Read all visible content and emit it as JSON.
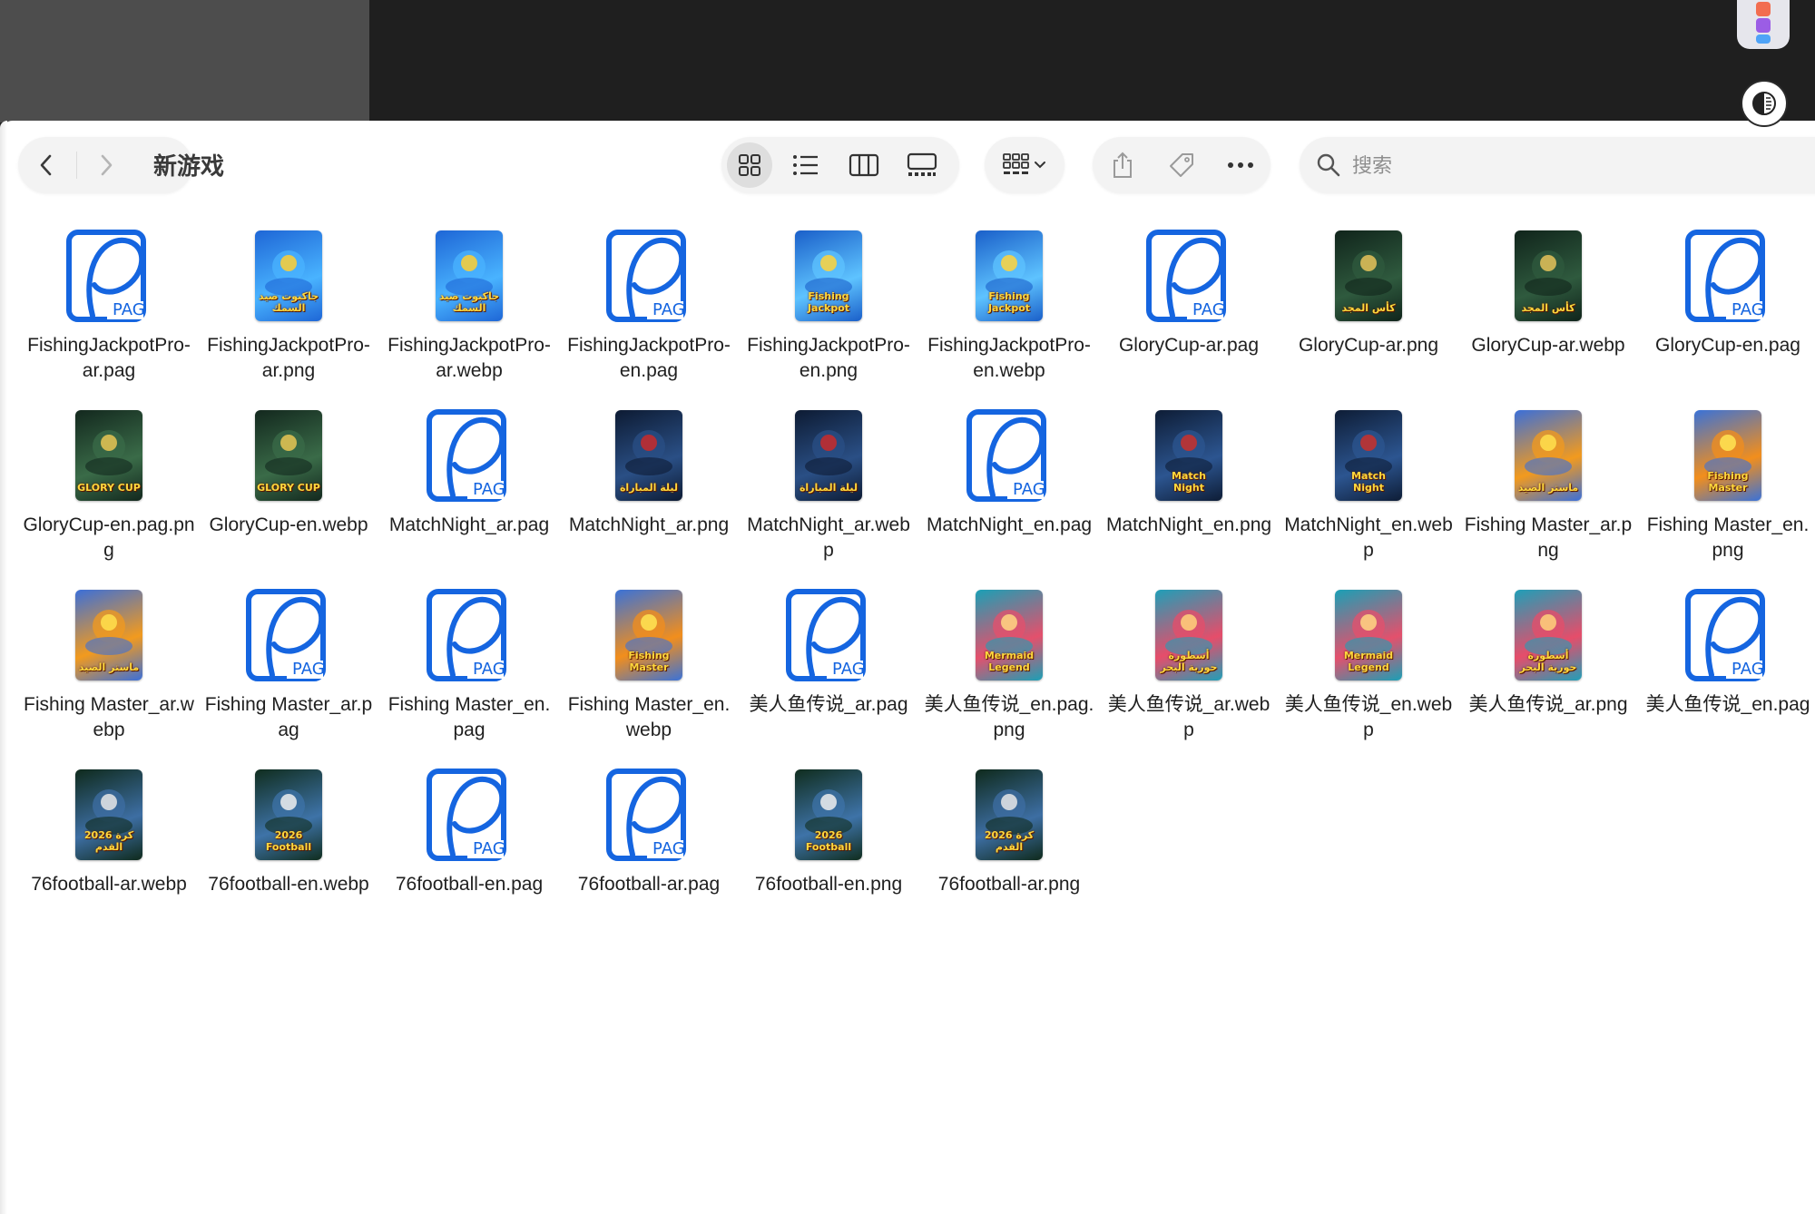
{
  "window": {
    "title": "新游戏",
    "search": {
      "placeholder": "搜索",
      "value": ""
    },
    "view_mode": "icons",
    "toolbar_icons": [
      "chevron-left-icon",
      "chevron-right-icon",
      "grid-view-icon",
      "list-view-icon",
      "column-view-icon",
      "gallery-view-icon",
      "group-by-icon",
      "share-icon",
      "tag-icon",
      "more-icon",
      "search-icon"
    ]
  },
  "files": [
    {
      "name": "FishingJackpotPro-ar.pag",
      "kind": "pag"
    },
    {
      "name": "FishingJackpotPro-ar.png",
      "kind": "img",
      "theme": "shark-ar"
    },
    {
      "name": "FishingJackpotPro-ar.webp",
      "kind": "img",
      "theme": "shark-ar"
    },
    {
      "name": "FishingJackpotPro-en.pag",
      "kind": "pag"
    },
    {
      "name": "FishingJackpotPro-en.png",
      "kind": "img",
      "theme": "shark-jackpot"
    },
    {
      "name": "FishingJackpotPro-en.webp",
      "kind": "img",
      "theme": "shark-jackpot"
    },
    {
      "name": "GloryCup-ar.pag",
      "kind": "pag"
    },
    {
      "name": "GloryCup-ar.png",
      "kind": "img",
      "theme": "glory-ar"
    },
    {
      "name": "GloryCup-ar.webp",
      "kind": "img",
      "theme": "glory-ar"
    },
    {
      "name": "GloryCup-en.pag",
      "kind": "pag"
    },
    {
      "name": "GloryCup-en.pag.png",
      "kind": "img",
      "theme": "glory-en"
    },
    {
      "name": "GloryCup-en.webp",
      "kind": "img",
      "theme": "glory-en"
    },
    {
      "name": "MatchNight_ar.pag",
      "kind": "pag"
    },
    {
      "name": "MatchNight_ar.png",
      "kind": "img",
      "theme": "match-ar"
    },
    {
      "name": "MatchNight_ar.webp",
      "kind": "img",
      "theme": "match-ar"
    },
    {
      "name": "MatchNight_en.pag",
      "kind": "pag"
    },
    {
      "name": "MatchNight_en.png",
      "kind": "img",
      "theme": "match-en"
    },
    {
      "name": "MatchNight_en.webp",
      "kind": "img",
      "theme": "match-en"
    },
    {
      "name": "Fishing Master_ar.png",
      "kind": "img",
      "theme": "fm-ar"
    },
    {
      "name": "Fishing Master_en.png",
      "kind": "img",
      "theme": "fm-en"
    },
    {
      "name": "Fishing Master_ar.webp",
      "kind": "img",
      "theme": "fm-ar"
    },
    {
      "name": "Fishing Master_ar.pag",
      "kind": "pag"
    },
    {
      "name": "Fishing Master_en.pag",
      "kind": "pag"
    },
    {
      "name": "Fishing Master_en.webp",
      "kind": "img",
      "theme": "fm-en"
    },
    {
      "name": "美人鱼传说_ar.pag",
      "kind": "pag"
    },
    {
      "name": "美人鱼传说_en.pag.png",
      "kind": "img",
      "theme": "mermaid-en"
    },
    {
      "name": "美人鱼传说_ar.webp",
      "kind": "img",
      "theme": "mermaid-ar"
    },
    {
      "name": "美人鱼传说_en.webp",
      "kind": "img",
      "theme": "mermaid-en"
    },
    {
      "name": "美人鱼传说_ar.png",
      "kind": "img",
      "theme": "mermaid-ar"
    },
    {
      "name": "美人鱼传说_en.pag",
      "kind": "pag"
    },
    {
      "name": "76football-ar.webp",
      "kind": "img",
      "theme": "ball-ar"
    },
    {
      "name": "76football-en.webp",
      "kind": "img",
      "theme": "ball-en"
    },
    {
      "name": "76football-en.pag",
      "kind": "pag"
    },
    {
      "name": "76football-ar.pag",
      "kind": "pag"
    },
    {
      "name": "76football-en.png",
      "kind": "img",
      "theme": "ball-en"
    },
    {
      "name": "76football-ar.png",
      "kind": "img",
      "theme": "ball-ar"
    }
  ],
  "thumbnail_captions": {
    "shark-ar": "جاكبوت صيد السمك",
    "shark-jackpot": "Fishing Jackpot",
    "glory-ar": "كأس المجد",
    "glory-en": "GLORY CUP",
    "match-ar": "ليلة المباراة",
    "match-en": "Match Night",
    "fm-ar": "ماستر الصيد",
    "fm-en": "Fishing Master",
    "mermaid-ar": "أسطورة حورية البحر",
    "mermaid-en": "Mermaid Legend",
    "ball-ar": "2026 كرة القدم",
    "ball-en": "2026 Football"
  },
  "pag_label": "PAG",
  "colors": {
    "pag_blue": "#1565e0",
    "window_bg": "#ffffff",
    "toolbar_pill": "#f3f3f3"
  }
}
